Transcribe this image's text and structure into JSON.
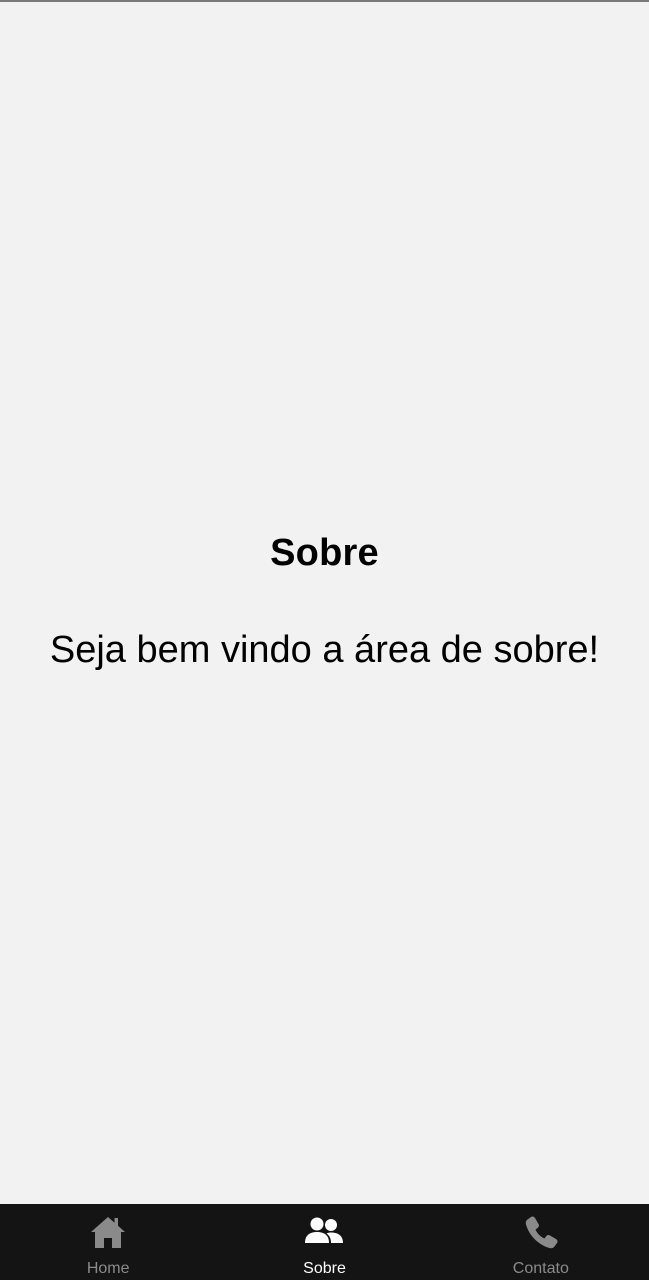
{
  "page": {
    "title": "Sobre",
    "message": "Seja bem vindo a área de sobre!"
  },
  "tabbar": {
    "active": "sobre",
    "items": [
      {
        "label": "Home",
        "icon": "home-icon"
      },
      {
        "label": "Sobre",
        "icon": "users-icon"
      },
      {
        "label": "Contato",
        "icon": "phone-icon"
      }
    ]
  },
  "colors": {
    "background": "#f2f2f2",
    "tabbar": "#141414",
    "active": "#ffffff",
    "inactive": "#8a8a8a"
  }
}
